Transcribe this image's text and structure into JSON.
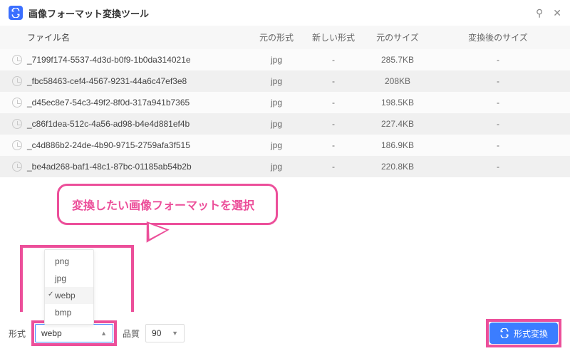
{
  "titlebar": {
    "title": "画像フォーマット変換ツール"
  },
  "table": {
    "headers": {
      "name": "ファイル名",
      "src_format": "元の形式",
      "new_format": "新しい形式",
      "src_size": "元のサイズ",
      "new_size": "変換後のサイズ"
    },
    "rows": [
      {
        "name": "_7199f174-5537-4d3d-b0f9-1b0da314021e",
        "src_format": "jpg",
        "new_format": "-",
        "src_size": "285.7KB",
        "new_size": "-"
      },
      {
        "name": "_fbc58463-cef4-4567-9231-44a6c47ef3e8",
        "src_format": "jpg",
        "new_format": "-",
        "src_size": "208KB",
        "new_size": "-"
      },
      {
        "name": "_d45ec8e7-54c3-49f2-8f0d-317a941b7365",
        "src_format": "jpg",
        "new_format": "-",
        "src_size": "198.5KB",
        "new_size": "-"
      },
      {
        "name": "_c86f1dea-512c-4a56-ad98-b4e4d881ef4b",
        "src_format": "jpg",
        "new_format": "-",
        "src_size": "227.4KB",
        "new_size": "-"
      },
      {
        "name": "_c4d886b2-24de-4b90-9715-2759afa3f515",
        "src_format": "jpg",
        "new_format": "-",
        "src_size": "186.9KB",
        "new_size": "-"
      },
      {
        "name": "_be4ad268-baf1-48c1-87bc-01185ab54b2b",
        "src_format": "jpg",
        "new_format": "-",
        "src_size": "220.8KB",
        "new_size": "-"
      }
    ]
  },
  "callout": {
    "text": "変換したい画像フォーマットを選択"
  },
  "format_options": [
    "png",
    "jpg",
    "webp",
    "bmp"
  ],
  "format_selected": "webp",
  "footer": {
    "format_label": "形式",
    "format_value": "webp",
    "quality_label": "品質",
    "quality_value": "90",
    "convert_button": "形式変換"
  }
}
